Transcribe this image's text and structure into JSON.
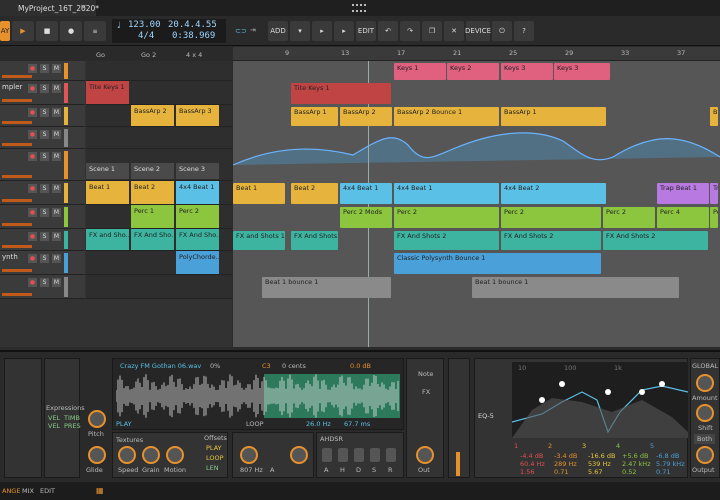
{
  "titlebar": {
    "project_tab": "MyProject_16T_2020*"
  },
  "toolbar": {
    "play_label": "AY",
    "tempo": "123.00",
    "time_signature": "4/4",
    "position": "20.4.4.55",
    "time": "0:38.969",
    "add_label": "ADD",
    "edit_label": "EDIT",
    "device_label": "DEVICE"
  },
  "ruler": [
    "9",
    "13",
    "17",
    "21",
    "25",
    "29",
    "33",
    "37",
    "41",
    "45"
  ],
  "tracks": [
    {
      "name": "",
      "color": "#e6912c"
    },
    {
      "name": "mpler",
      "color": "#e05555"
    },
    {
      "name": "",
      "color": "#e6b43c"
    },
    {
      "name": "",
      "color": "#888888"
    },
    {
      "name": "",
      "color": "#e6912c"
    },
    {
      "name": "",
      "color": "#e6b43c"
    },
    {
      "name": "",
      "color": "#8cc63f"
    },
    {
      "name": "",
      "color": "#3cb4a0"
    },
    {
      "name": "ynth",
      "color": "#4aa0d8"
    },
    {
      "name": "",
      "color": "#888888"
    }
  ],
  "launcher": {
    "headers": [
      "Go",
      "Go 2",
      "4 x 4"
    ],
    "scenes": [
      "Scene 1",
      "Scene 2",
      "Scene 3"
    ],
    "clips": [
      {
        "col": 0,
        "row": 1,
        "label": "Tite Keys 1",
        "color": "#c04444"
      },
      {
        "col": 1,
        "row": 2,
        "label": "BassArp 2",
        "color": "#e6b43c"
      },
      {
        "col": 2,
        "row": 2,
        "label": "BassArp 3",
        "color": "#e6b43c"
      },
      {
        "col": 0,
        "row": 5,
        "label": "Beat 1",
        "color": "#e6b43c"
      },
      {
        "col": 1,
        "row": 5,
        "label": "Beat 2",
        "color": "#e6b43c"
      },
      {
        "col": 2,
        "row": 5,
        "label": "4x4 Beat 1",
        "color": "#5bc0e6"
      },
      {
        "col": 1,
        "row": 6,
        "label": "Perc 1",
        "color": "#8cc63f"
      },
      {
        "col": 2,
        "row": 6,
        "label": "Perc 2",
        "color": "#8cc63f"
      },
      {
        "col": 0,
        "row": 7,
        "label": "FX and Sho..",
        "color": "#3cb4a0"
      },
      {
        "col": 1,
        "row": 7,
        "label": "FX And Sho..",
        "color": "#3cb4a0"
      },
      {
        "col": 2,
        "row": 7,
        "label": "FX And Sho..",
        "color": "#3cb4a0"
      },
      {
        "col": 2,
        "row": 8,
        "label": "PolyChorde..",
        "color": "#4aa0d8"
      }
    ]
  },
  "arranger_clips": [
    {
      "row": 0,
      "start": 0.33,
      "end": 0.44,
      "label": "Keys 1",
      "color": "#e06080"
    },
    {
      "row": 0,
      "start": 0.44,
      "end": 0.55,
      "label": "Keys 2",
      "color": "#e06080"
    },
    {
      "row": 0,
      "start": 0.55,
      "end": 0.66,
      "label": "Keys 3",
      "color": "#e06080"
    },
    {
      "row": 0,
      "start": 0.66,
      "end": 0.78,
      "label": "Keys 3",
      "color": "#e06080"
    },
    {
      "row": 1,
      "start": 0.12,
      "end": 0.33,
      "label": "Tite Keys 1",
      "color": "#c04444"
    },
    {
      "row": 2,
      "start": 0.12,
      "end": 0.22,
      "label": "BassArp 1",
      "color": "#e6b43c"
    },
    {
      "row": 2,
      "start": 0.22,
      "end": 0.33,
      "label": "BassArp 2",
      "color": "#e6b43c"
    },
    {
      "row": 2,
      "start": 0.33,
      "end": 0.55,
      "label": "BassArp 2 Bounce 1",
      "color": "#e6b43c"
    },
    {
      "row": 2,
      "start": 0.55,
      "end": 0.77,
      "label": "BassArp 1",
      "color": "#e6b43c"
    },
    {
      "row": 2,
      "start": 0.98,
      "end": 1.0,
      "label": "Bass",
      "color": "#e6b43c"
    },
    {
      "row": 5,
      "start": 0.0,
      "end": 0.11,
      "label": "Beat 1",
      "color": "#e6b43c"
    },
    {
      "row": 5,
      "start": 0.12,
      "end": 0.22,
      "label": "Beat 2",
      "color": "#e6b43c"
    },
    {
      "row": 5,
      "start": 0.22,
      "end": 0.33,
      "label": "4x4 Beat 1",
      "color": "#5bc0e6"
    },
    {
      "row": 5,
      "start": 0.33,
      "end": 0.55,
      "label": "4x4 Beat 1",
      "color": "#5bc0e6"
    },
    {
      "row": 5,
      "start": 0.55,
      "end": 0.77,
      "label": "4x4 Beat 2",
      "color": "#5bc0e6"
    },
    {
      "row": 5,
      "start": 0.87,
      "end": 0.98,
      "label": "Trap Beat 1",
      "color": "#b87ae0"
    },
    {
      "row": 5,
      "start": 0.98,
      "end": 1.0,
      "label": "Trap",
      "color": "#b87ae0"
    },
    {
      "row": 6,
      "start": 0.22,
      "end": 0.33,
      "label": "Perc 2 Mods",
      "color": "#8cc63f"
    },
    {
      "row": 6,
      "start": 0.33,
      "end": 0.55,
      "label": "Perc 2",
      "color": "#8cc63f"
    },
    {
      "row": 6,
      "start": 0.55,
      "end": 0.76,
      "label": "Perc 2",
      "color": "#8cc63f"
    },
    {
      "row": 6,
      "start": 0.76,
      "end": 0.87,
      "label": "Perc 2",
      "color": "#8cc63f"
    },
    {
      "row": 6,
      "start": 0.87,
      "end": 0.98,
      "label": "Perc 4",
      "color": "#8cc63f"
    },
    {
      "row": 6,
      "start": 0.98,
      "end": 1.0,
      "label": "Perc",
      "color": "#8cc63f"
    },
    {
      "row": 7,
      "start": 0.0,
      "end": 0.11,
      "label": "FX and Shots 1",
      "color": "#3cb4a0"
    },
    {
      "row": 7,
      "start": 0.12,
      "end": 0.22,
      "label": "FX And Shots 2",
      "color": "#3cb4a0"
    },
    {
      "row": 7,
      "start": 0.33,
      "end": 0.55,
      "label": "FX And Shots 2",
      "color": "#3cb4a0"
    },
    {
      "row": 7,
      "start": 0.55,
      "end": 0.76,
      "label": "FX And Shots 2",
      "color": "#3cb4a0"
    },
    {
      "row": 7,
      "start": 0.76,
      "end": 0.98,
      "label": "FX And Shots 2",
      "color": "#3cb4a0"
    },
    {
      "row": 8,
      "start": 0.33,
      "end": 0.76,
      "label": "Classic Polysynth Bounce 1",
      "color": "#4aa0d8"
    },
    {
      "row": 9,
      "start": 0.06,
      "end": 0.33,
      "label": "Beat 1 bounce 1",
      "color": "#8a8a8a"
    },
    {
      "row": 9,
      "start": 0.49,
      "end": 0.92,
      "label": "Beat 1 bounce 1",
      "color": "#8a8a8a"
    }
  ],
  "sampler": {
    "file": "Crazy FM Gothan 06.wav",
    "root": "C3",
    "cents": "0 cents",
    "gain": "0.0 dB",
    "pct": "0%",
    "play_label": "PLAY",
    "loop_label": "LOOP",
    "freq1": "26.0 Hz",
    "freq2": "67.7 ms",
    "textures_label": "Textures",
    "offsets_label": "Offsets",
    "offsets_items": [
      "PLAY",
      "LOOP",
      "LEN"
    ],
    "knobs": [
      "Speed",
      "Grain",
      "Motion"
    ],
    "env_label": "AHDSR",
    "env_knobs": [
      "A",
      "H",
      "D",
      "S",
      "R"
    ],
    "filter_freq": "807 Hz",
    "filter_knob": "A",
    "note_label": "Note",
    "fx_label": "FX",
    "out_label": "Out",
    "pitch_label": "Pitch",
    "glide_label": "Glide",
    "expressions_label": "Expressions",
    "expr_items": [
      "VEL",
      "TIMB",
      "VEL",
      "PRES"
    ]
  },
  "eq": {
    "title": "EQ-5",
    "bands": [
      {
        "num": "1",
        "gain": "-4.4 dB",
        "freq": "60.4 Hz",
        "q": "1.56",
        "color": "#e05050"
      },
      {
        "num": "2",
        "gain": "-3.4 dB",
        "freq": "289 Hz",
        "q": "0.71",
        "color": "#e6912c"
      },
      {
        "num": "3",
        "gain": "-16.6 dB",
        "freq": "539 Hz",
        "q": "5.67",
        "color": "#e6c83c"
      },
      {
        "num": "4",
        "gain": "+5.6 dB",
        "freq": "2.47 kHz",
        "q": "0.52",
        "color": "#8cc63f"
      },
      {
        "num": "5",
        "gain": "-6.8 dB",
        "freq": "5.79 kHz",
        "q": "0.71",
        "color": "#4aa0d8"
      }
    ],
    "global_label": "GLOBAL",
    "amount_label": "Amount",
    "shift_label": "Shift",
    "mode": "Both",
    "output_label": "Output",
    "scale": [
      "10",
      "100",
      "1k"
    ]
  },
  "statusbar": {
    "items": [
      "ANGE",
      "MIX",
      "EDIT"
    ]
  }
}
